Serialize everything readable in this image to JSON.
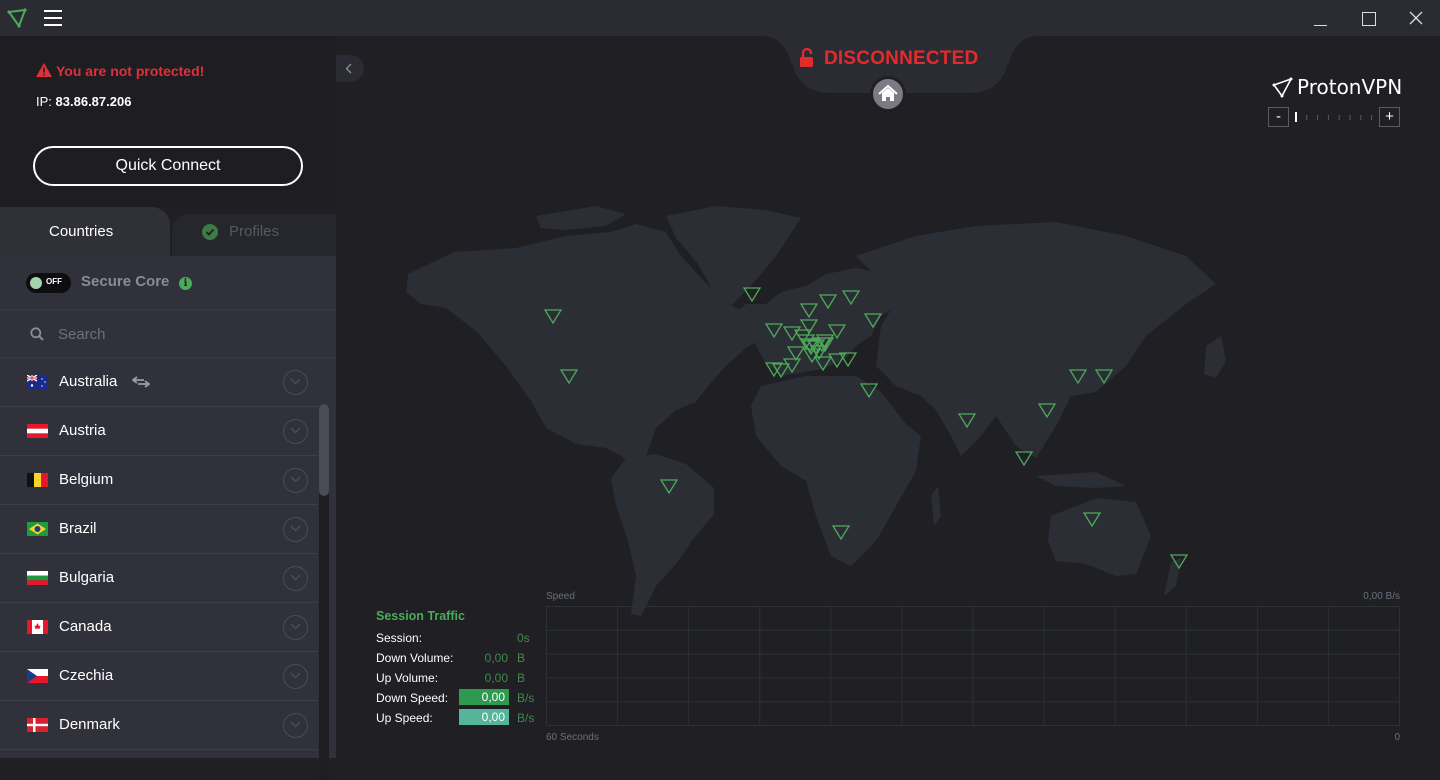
{
  "app": {
    "title": "ProtonVPN",
    "logo_icon": "protonvpn-logo-icon",
    "window_controls": [
      "minimize",
      "maximize",
      "close"
    ]
  },
  "status": {
    "warning": "You are not protected!",
    "ip_label": "IP:",
    "ip_value": "83.86.87.206",
    "connection_state": "DISCONNECTED",
    "quick_connect_label": "Quick Connect"
  },
  "tabs": [
    {
      "label": "Countries",
      "active": true
    },
    {
      "label": "Profiles",
      "active": false
    }
  ],
  "secure_core": {
    "label": "Secure Core",
    "toggle_state": "OFF"
  },
  "search": {
    "placeholder": "Search",
    "value": ""
  },
  "countries": [
    {
      "name": "Australia",
      "flag": "au",
      "p2p": true
    },
    {
      "name": "Austria",
      "flag": "at",
      "p2p": false
    },
    {
      "name": "Belgium",
      "flag": "be",
      "p2p": false
    },
    {
      "name": "Brazil",
      "flag": "br",
      "p2p": false
    },
    {
      "name": "Bulgaria",
      "flag": "bg",
      "p2p": false
    },
    {
      "name": "Canada",
      "flag": "ca",
      "p2p": false
    },
    {
      "name": "Czechia",
      "flag": "cz",
      "p2p": false
    },
    {
      "name": "Denmark",
      "flag": "dk",
      "p2p": false
    }
  ],
  "map": {
    "brand": "ProtonVPN",
    "zoom_minus": "-",
    "zoom_plus": "+",
    "zoom_level_fraction": 0.0,
    "server_marker_color": "#4caa5a",
    "server_count_visible": 38
  },
  "session_traffic": {
    "title": "Session Traffic",
    "rows": [
      {
        "label": "Session:",
        "value": "0s",
        "unit": ""
      },
      {
        "label": "Down Volume:",
        "value": "0,00",
        "unit": "B"
      },
      {
        "label": "Up Volume:",
        "value": "0,00",
        "unit": "B"
      },
      {
        "label": "Down Speed:",
        "value": "0,00",
        "unit": "B/s"
      },
      {
        "label": "Up Speed:",
        "value": "0,00",
        "unit": "B/s"
      }
    ]
  },
  "speed_graph": {
    "title": "Speed",
    "max_label": "0,00  B/s",
    "x_start_label": "60 Seconds",
    "x_end_label": "0"
  },
  "colors": {
    "accent_green": "#4caa5a",
    "danger_red": "#e42a2a",
    "down_speed_bg": "#2e9a50",
    "up_speed_bg": "#55b59a"
  }
}
